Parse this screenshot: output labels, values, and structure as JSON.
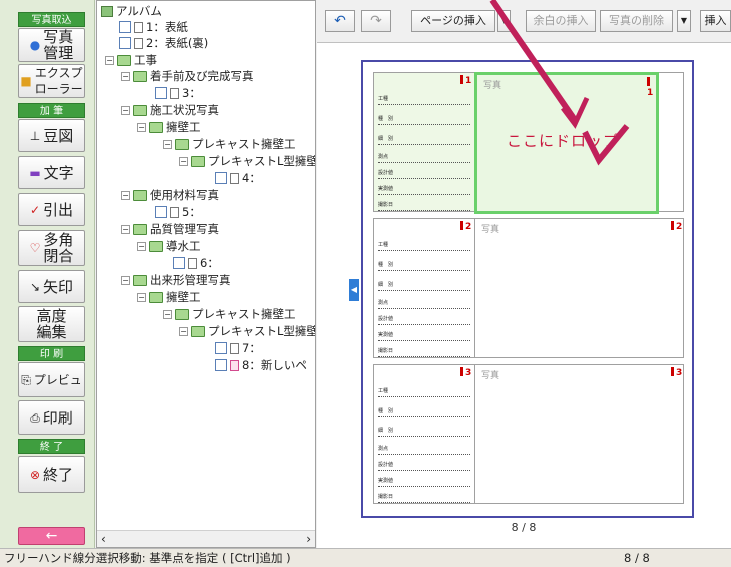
{
  "sidebar": {
    "sec_photo": "写真取込",
    "photo_manage": [
      "写真",
      "管理"
    ],
    "explorer": [
      "エクスプ",
      "ローラー"
    ],
    "sec_add": "加 筆",
    "mame": "豆図",
    "text": "文字",
    "hikidashi": "引出",
    "polygon": [
      "多角",
      "閉合"
    ],
    "arrow": "矢印",
    "advanced": [
      "高度",
      "編集"
    ],
    "sec_print": "印 刷",
    "preview": "プレビュ",
    "print": "印刷",
    "sec_end": "終 了",
    "exit": "終了",
    "back": "←"
  },
  "tree": {
    "album": "アルバム",
    "p1": "1：表紙",
    "p2": "2：表紙(裏)",
    "kouji": "工事",
    "chakushu": "着手前及び完成写真",
    "p3": "3：",
    "sekou": "施工状況写真",
    "yoheki": "擁壁工",
    "precast": "プレキャスト擁壁工",
    "precast_l": "プレキャストL型擁壁",
    "p4": "4：",
    "shiyou": "使用材料写真",
    "p5": "5：",
    "hinshitsu": "品質管理写真",
    "dousui": "導水工",
    "p6": "6：",
    "dekigata": "出来形管理写真",
    "yoheki2": "擁壁工",
    "precast2": "プレキャスト擁壁工",
    "precast_l2": "プレキャストL型擁壁",
    "p7": "7：",
    "p8": "8：新しいペ"
  },
  "toolbar": {
    "page_insert": "ページの挿入",
    "margin_insert": "余白の挿入",
    "photo_delete": "写真の削除",
    "insert": "挿入"
  },
  "page": {
    "photo_label": "写真",
    "drop_hint": "ここにドロップ",
    "slots": [
      "1",
      "2",
      "3"
    ],
    "info_rows": [
      "工種",
      "種　別",
      "細　別",
      "測点",
      "設計値",
      "実測値",
      "撮影日"
    ],
    "indicator": "8 / 8"
  },
  "status": {
    "message": "フリーハンド線分選択移動: 基準点を指定 ( [Ctrl]追加 )",
    "page": "8 / 8"
  }
}
